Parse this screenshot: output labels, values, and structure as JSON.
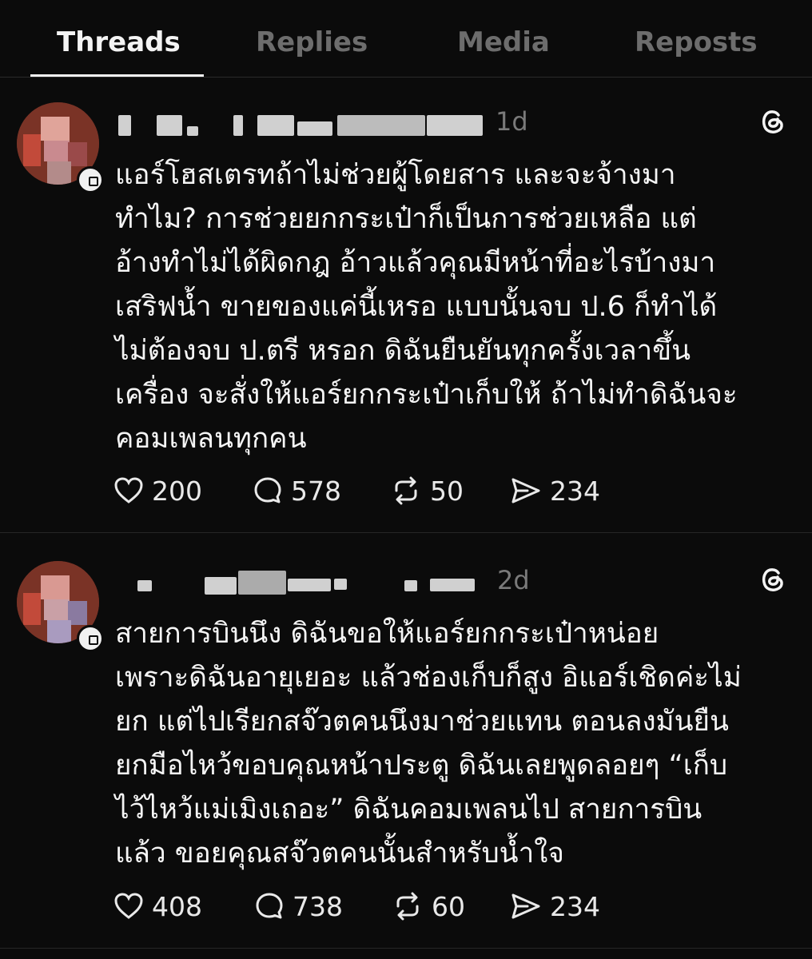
{
  "tabs": [
    "Threads",
    "Replies",
    "Media",
    "Reposts"
  ],
  "posts": [
    {
      "timestamp": "1d",
      "text": "แอร์โฮสเตรทถ้าไม่ช่วยผู้โดยสาร และจะจ้างมา\nทำไม?  การช่วยยกกระเป๋าก็เป็นการช่วยเหลือ แต่\nอ้างทำไม่ได้ผิดกฎ อ้าวแล้วคุณมีหน้าที่อะไรบ้างมา\nเสริฟน้ำ ขายของแค่นี้เหรอ แบบนั้นจบ ป.6 ก็ทำได้\nไม่ต้องจบ ป.ตรี หรอก ดิฉันยืนยันทุกครั้งเวลาขึ้น\nเครื่อง จะสั่งให้แอร์ยกกระเป๋าเก็บให้ ถ้าไม่ทำดิฉันจะ\nคอมเพลนทุกคน",
      "likes": "200",
      "replies": "578",
      "reposts": "50",
      "shares": "234"
    },
    {
      "timestamp": "2d",
      "text": "สายการบินนึง ดิฉันขอให้แอร์ยกกระเป๋าหน่อย\nเพราะดิฉันอายุเยอะ แล้วช่องเก็บก็สูง อิแอร์เชิดค่ะไม่\nยก แต่ไปเรียกสจ๊วตคนนึงมาช่วยแทน ตอนลงมันยืน\nยกมือไหว้ขอบคุณหน้าประตู ดิฉันเลยพูดลอยๆ “เก็บ\nไว้ไหว้แม่เมิงเถอะ” ดิฉันคอมเพลนไป สายการบิน\nแล้ว ขอยคุณสจ๊วตคนนั้นสำหรับน้ำใจ",
      "likes": "408",
      "replies": "738",
      "reposts": "60",
      "shares": "234"
    }
  ],
  "icons": {
    "like": "heart-icon",
    "reply": "comment-icon",
    "repost": "repost-icon",
    "share": "send-icon",
    "brand": "threads-logo-icon"
  },
  "colors": {
    "background": "#0b0b0b",
    "text": "#f3f3f3",
    "muted": "#6d6d6d",
    "divider": "#262626"
  }
}
